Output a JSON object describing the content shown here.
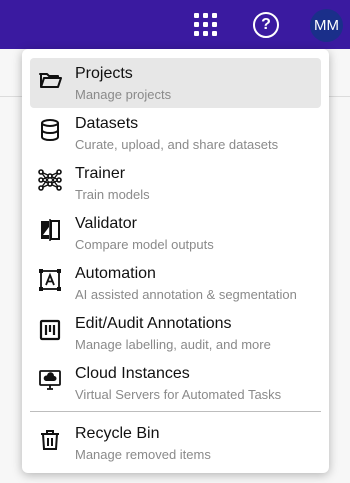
{
  "header": {
    "avatar_initials": "MM",
    "help_glyph": "?",
    "apps_icon": "grid-icon",
    "colors": {
      "bar": "#3a1aa0",
      "avatar": "#1a2f8a"
    }
  },
  "menu": {
    "items": [
      {
        "title": "Projects",
        "desc": "Manage projects",
        "icon": "folder-open-icon"
      },
      {
        "title": "Datasets",
        "desc": "Curate, upload, and share datasets",
        "icon": "database-icon"
      },
      {
        "title": "Trainer",
        "desc": "Train models",
        "icon": "neural-network-icon"
      },
      {
        "title": "Validator",
        "desc": "Compare model outputs",
        "icon": "compare-icon"
      },
      {
        "title": "Automation",
        "desc": "AI assisted annotation & segmentation",
        "icon": "auto-annotate-icon"
      },
      {
        "title": "Edit/Audit Annotations",
        "desc": "Manage labelling, audit, and more",
        "icon": "board-icon"
      },
      {
        "title": "Cloud Instances",
        "desc": "Virtual Servers for Automated Tasks",
        "icon": "cloud-desktop-icon"
      },
      {
        "title": "Recycle Bin",
        "desc": "Manage removed items",
        "icon": "trash-icon"
      }
    ]
  }
}
